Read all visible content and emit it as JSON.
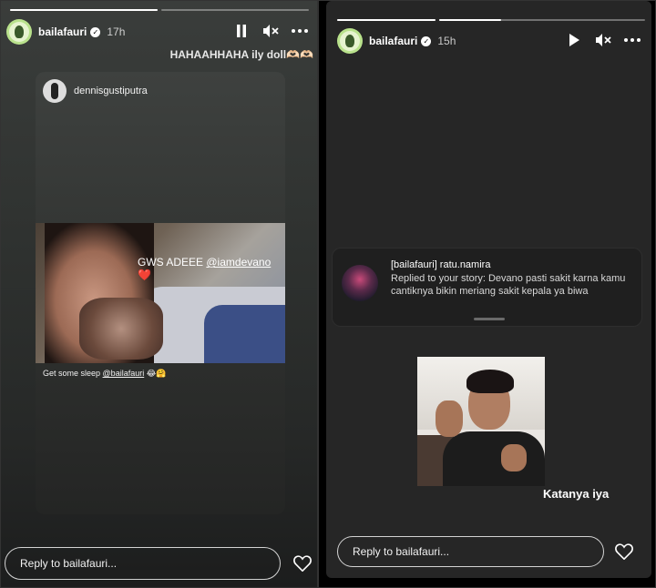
{
  "left_story": {
    "progress": [
      1,
      0
    ],
    "username": "bailafauri",
    "verified_badge": "✓",
    "time": "17h",
    "icons": [
      "pause-icon",
      "mute-icon",
      "more-icon"
    ],
    "caption": "HAHAAHHAHA ily doll🫶🏻🫶🏻",
    "shared_post": {
      "username": "dennisgustiputra",
      "photo_text": "GWS ADEEE",
      "photo_mention": "@iamdevano",
      "photo_emoji": "❤️",
      "caption_text": "Get some sleep",
      "caption_mention": "@bailafauri",
      "caption_emoji": "😂🤗"
    },
    "reply_placeholder": "Reply to bailafauri...",
    "heart_icon": "heart-icon"
  },
  "right_story": {
    "progress": [
      1,
      0.3
    ],
    "username": "bailafauri",
    "verified_badge": "✓",
    "time": "15h",
    "icons": [
      "play-icon",
      "mute-icon",
      "more-icon"
    ],
    "reply_card": {
      "title": "[bailafauri] ratu.namira",
      "body": "Replied to your story: Devano pasti sakit karna kamu cantiknya bikin meriang sakit kepala ya biwa"
    },
    "caption": "Katanya iya",
    "reply_placeholder": "Reply to bailafauri...",
    "heart_icon": "heart-icon"
  },
  "colors": {
    "avatar_ring": "#b9e28c",
    "panel_bg_right": "#262626",
    "like": "#ff2b40"
  }
}
